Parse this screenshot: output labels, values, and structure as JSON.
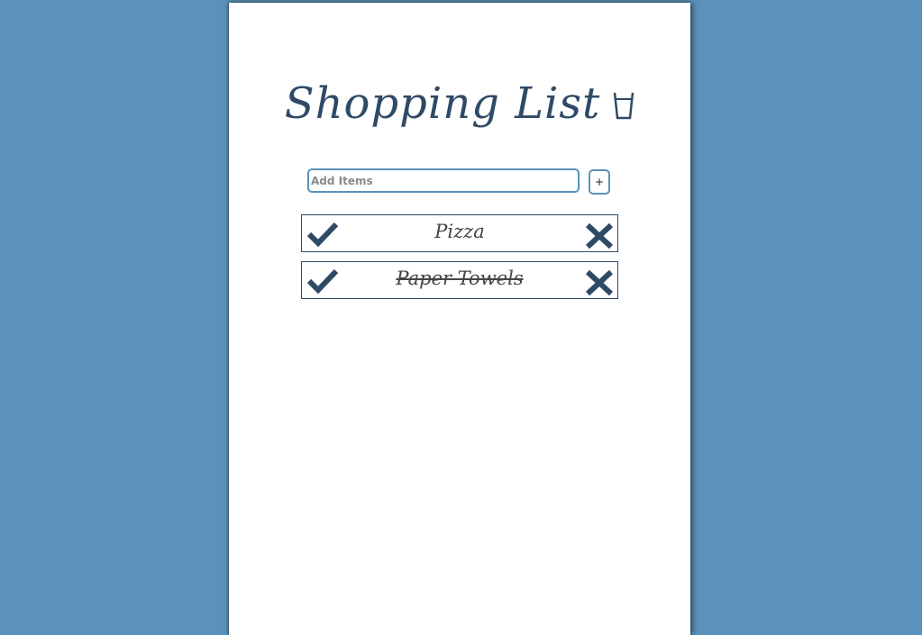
{
  "header": {
    "title": "Shopping List",
    "icon": "cup-icon"
  },
  "add_form": {
    "placeholder": "Add Items",
    "value": "",
    "button_label": "+"
  },
  "items": [
    {
      "label": "Pizza",
      "completed": false
    },
    {
      "label": "Paper Towels",
      "completed": true
    }
  ],
  "colors": {
    "background": "#5b91ba",
    "paper": "#ffffff",
    "accent": "#2f4a66",
    "input_border": "#5b91ba"
  }
}
